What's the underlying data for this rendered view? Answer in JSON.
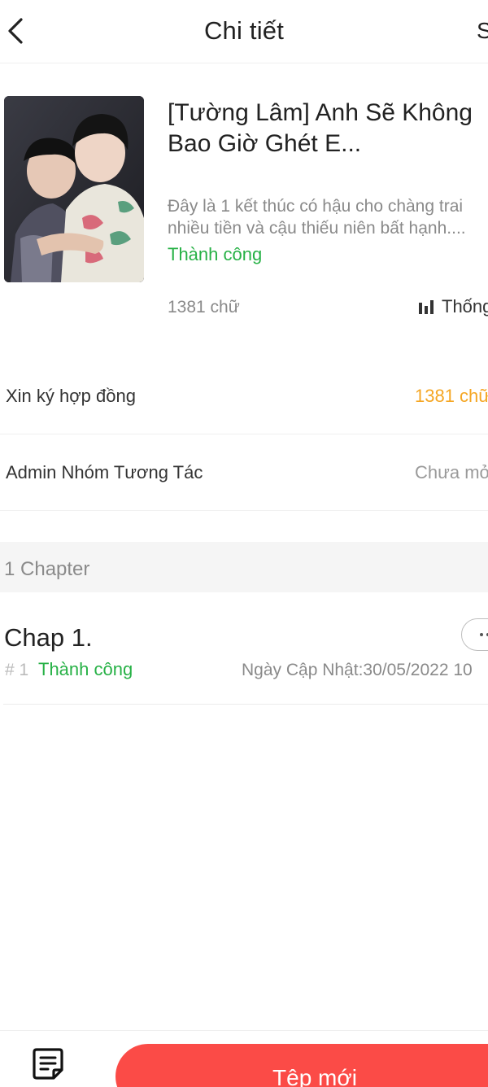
{
  "header": {
    "title": "Chi tiết",
    "right_action": "S"
  },
  "book": {
    "title": "[Tường Lâm] Anh Sẽ Không Bao Giờ Ghét E...",
    "description_line1": "Đây là 1 kết thúc có hậu cho chàng trai",
    "description_line2": "nhiều tiền và cậu thiếu niên bất hạnh....",
    "status": "Thành công",
    "word_count": "1381 chữ",
    "stats_label": "Thống"
  },
  "settings": {
    "contract": {
      "label": "Xin ký hợp đồng",
      "value": "1381 chữ"
    },
    "admin_group": {
      "label": "Admin Nhóm Tương Tác",
      "value": "Chưa mở"
    }
  },
  "chapters_section": {
    "header": "1 Chapter",
    "items": [
      {
        "title": "Chap 1.",
        "number": "# 1",
        "status": "Thành công",
        "updated": "Ngày Cập Nhật:30/05/2022 10"
      }
    ]
  },
  "bottom_bar": {
    "new_file_label": "Tệp mới"
  },
  "colors": {
    "success": "#27b146",
    "accent_orange": "#f5a623",
    "primary_red": "#fb4b47",
    "muted_text": "#8a8a8a"
  },
  "icons": {
    "back": "chevron-left-icon",
    "stats": "bar-chart-icon",
    "more": "ellipsis-icon",
    "draft": "note-icon"
  }
}
